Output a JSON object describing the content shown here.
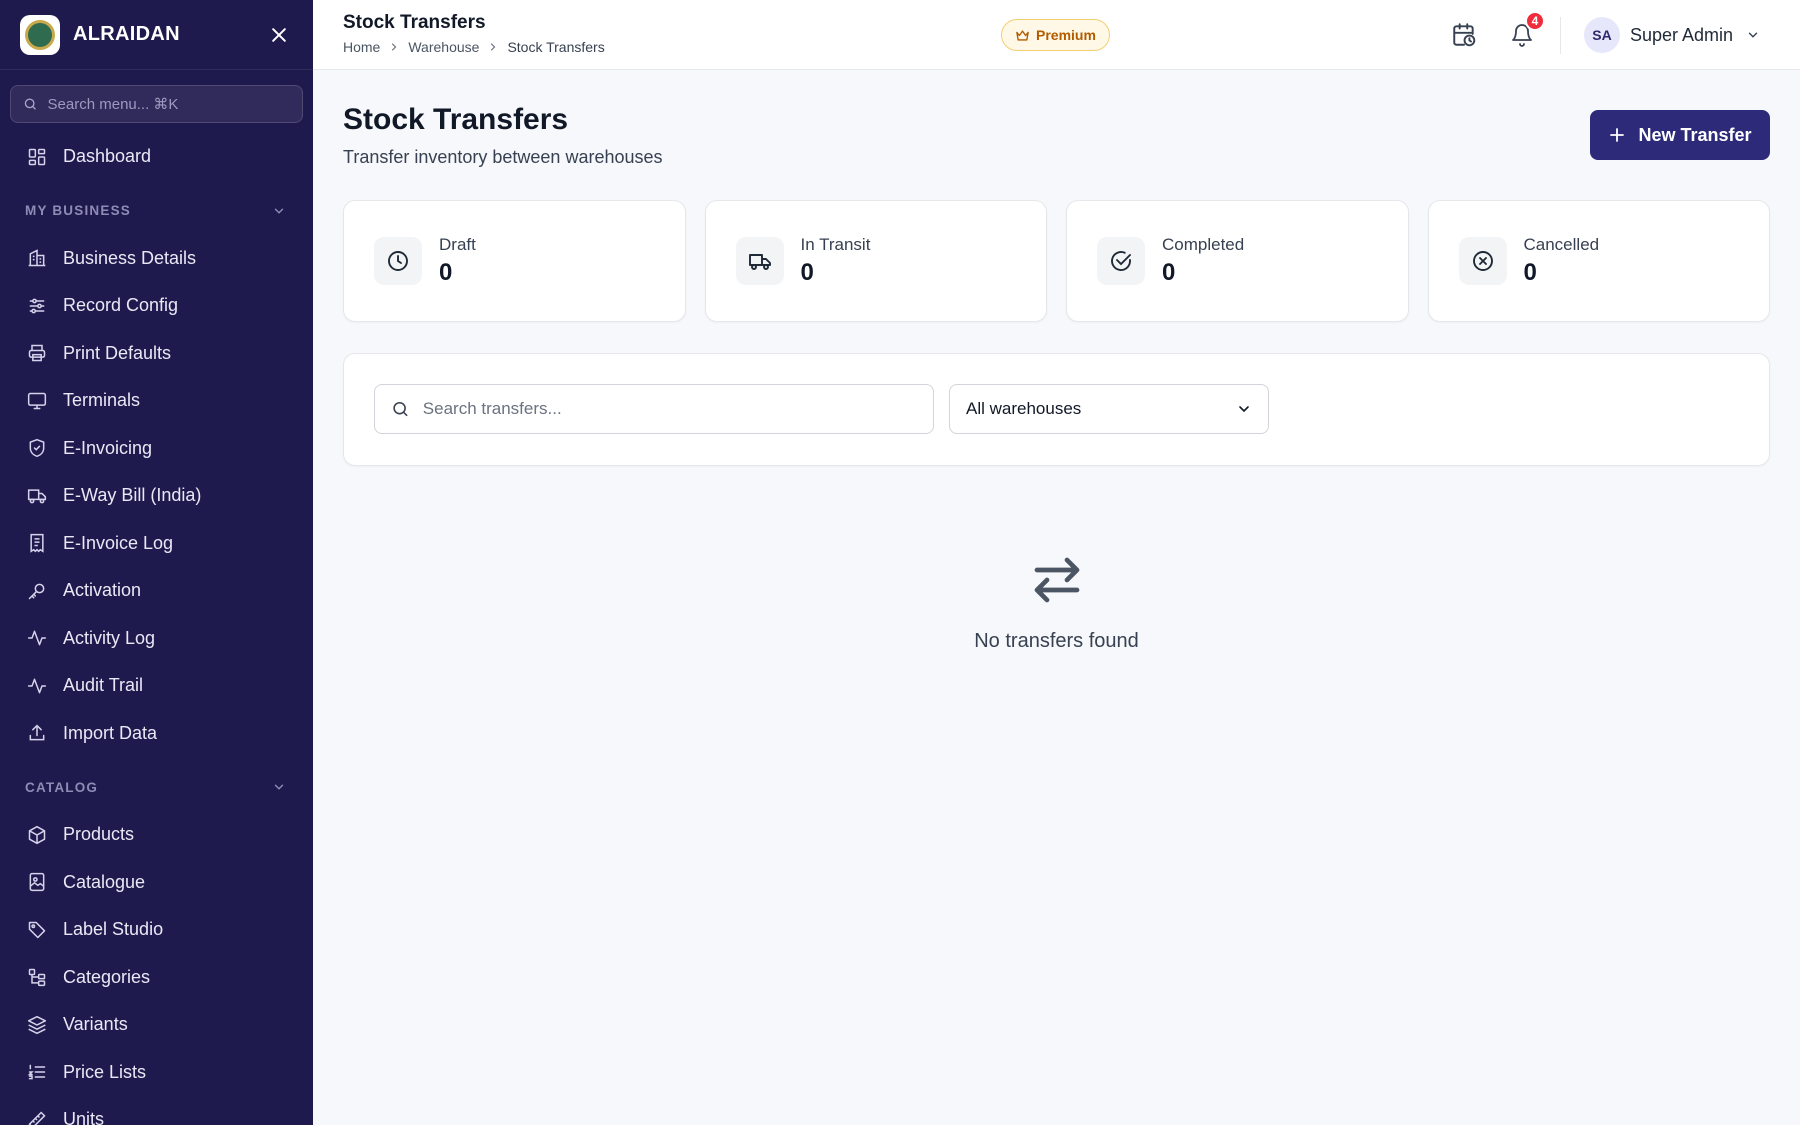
{
  "app": {
    "name": "ALRAIDAN"
  },
  "sidebar": {
    "search_placeholder": "Search menu... ⌘K",
    "top_item": {
      "label": "Dashboard",
      "icon": "dashboard-icon"
    },
    "sections": [
      {
        "title": "MY BUSINESS",
        "items": [
          {
            "label": "Business Details",
            "icon": "building-icon"
          },
          {
            "label": "Record Config",
            "icon": "sliders-icon"
          },
          {
            "label": "Print Defaults",
            "icon": "printer-icon"
          },
          {
            "label": "Terminals",
            "icon": "monitor-icon"
          },
          {
            "label": "E-Invoicing",
            "icon": "shield-check-icon"
          },
          {
            "label": "E-Way Bill (India)",
            "icon": "truck-icon"
          },
          {
            "label": "E-Invoice Log",
            "icon": "receipt-icon"
          },
          {
            "label": "Activation",
            "icon": "key-icon"
          },
          {
            "label": "Activity Log",
            "icon": "activity-icon"
          },
          {
            "label": "Audit Trail",
            "icon": "activity-icon"
          },
          {
            "label": "Import Data",
            "icon": "upload-icon"
          }
        ]
      },
      {
        "title": "CATALOG",
        "items": [
          {
            "label": "Products",
            "icon": "package-icon"
          },
          {
            "label": "Catalogue",
            "icon": "image-book-icon"
          },
          {
            "label": "Label Studio",
            "icon": "tag-icon"
          },
          {
            "label": "Categories",
            "icon": "hierarchy-icon"
          },
          {
            "label": "Variants",
            "icon": "layers-icon"
          },
          {
            "label": "Price Lists",
            "icon": "list-ordered-icon"
          },
          {
            "label": "Units",
            "icon": "ruler-icon"
          }
        ]
      }
    ]
  },
  "header": {
    "title": "Stock Transfers",
    "breadcrumb": [
      "Home",
      "Warehouse",
      "Stock Transfers"
    ],
    "premium_label": "Premium",
    "notification_count": "4",
    "user": {
      "initials": "SA",
      "name": "Super Admin"
    }
  },
  "page": {
    "title": "Stock Transfers",
    "subtitle": "Transfer inventory between warehouses",
    "new_button_label": "New Transfer",
    "stats": [
      {
        "label": "Draft",
        "value": "0",
        "icon": "clock-icon"
      },
      {
        "label": "In Transit",
        "value": "0",
        "icon": "truck-icon"
      },
      {
        "label": "Completed",
        "value": "0",
        "icon": "check-circle-icon"
      },
      {
        "label": "Cancelled",
        "value": "0",
        "icon": "x-circle-icon"
      }
    ],
    "search_placeholder": "Search transfers...",
    "warehouse_filter": "All warehouses",
    "empty_text": "No transfers found"
  },
  "colors": {
    "sidebar_bg": "#1f1a4d",
    "primary": "#2d2a7a",
    "badge": "#ef2b3c",
    "premium_bg": "#fff8e6",
    "premium_text": "#b25c00"
  }
}
